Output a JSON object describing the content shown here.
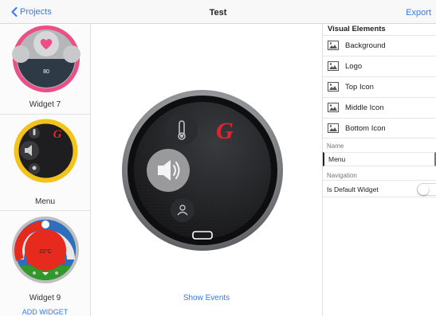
{
  "nav": {
    "back_label": "Projects",
    "title": "Test",
    "export_label": "Export"
  },
  "widgets": [
    {
      "label": "Widget 7",
      "readout": "80"
    },
    {
      "label": "Menu"
    },
    {
      "label": "Widget 9",
      "readout": "22°C"
    }
  ],
  "add_widget_label": "ADD WIDGET",
  "show_events_label": "Show Events",
  "visual_elements": {
    "title": "Visual Elements",
    "items": [
      {
        "label": "Background"
      },
      {
        "label": "Logo"
      },
      {
        "label": "Top Icon"
      },
      {
        "label": "Middle Icon"
      },
      {
        "label": "Bottom Icon"
      }
    ]
  },
  "name_field": {
    "label": "Name",
    "value": "Menu"
  },
  "navigation": {
    "label": "Navigation",
    "default_label": "Is Default Widget",
    "is_default": false
  },
  "colors": {
    "accent": "#3478f6",
    "pink_ring": "#ec4f86",
    "yellow_ring": "#f3c31a",
    "red_logo": "#e1252f",
    "green_band": "#2f9a2a",
    "temp_red": "#e62a1e"
  }
}
